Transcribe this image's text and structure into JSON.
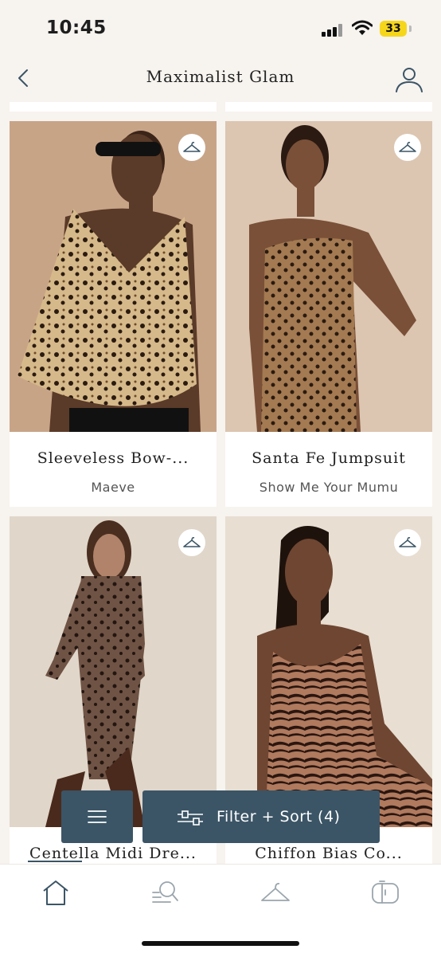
{
  "status_bar": {
    "time": "10:45",
    "battery": "33"
  },
  "header": {
    "title": "Maximalist Glam",
    "back_icon": "chevron-left-icon",
    "account_icon": "user-icon"
  },
  "products": [
    {
      "name": "Sleeveless Bow-...",
      "brand": "Maeve",
      "wishlist_icon": "hanger-icon"
    },
    {
      "name": "Santa Fe Jumpsuit",
      "brand": "Show Me Your Mumu",
      "wishlist_icon": "hanger-icon"
    },
    {
      "name": "Centella Midi Dre...",
      "brand": "",
      "wishlist_icon": "hanger-icon"
    },
    {
      "name": "Chiffon Bias Co...",
      "brand": "",
      "wishlist_icon": "hanger-icon"
    }
  ],
  "controls": {
    "menu_icon": "hamburger-icon",
    "filter_label": "Filter + Sort (4)",
    "filter_icon": "sliders-icon"
  },
  "bottom_nav": [
    {
      "name": "home",
      "icon": "home-icon"
    },
    {
      "name": "search",
      "icon": "search-icon"
    },
    {
      "name": "hanger",
      "icon": "hanger-icon"
    },
    {
      "name": "closet",
      "icon": "closet-icon"
    }
  ],
  "colors": {
    "accent": "#3b5566",
    "background": "#f7f3ef",
    "battery": "#f6d61b"
  }
}
